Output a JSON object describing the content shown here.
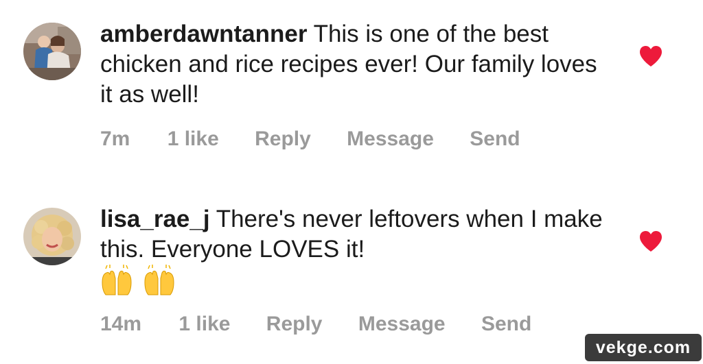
{
  "comments": [
    {
      "username": "amberdawntanner",
      "text": "This is one of the best chicken and rice recipes ever! Our family loves it as well!",
      "time": "7m",
      "likes": "1 like",
      "reply": "Reply",
      "message": "Message",
      "send": "Send",
      "liked": true
    },
    {
      "username": "lisa_rae_j",
      "text": "There's never leftovers when I make this.  Everyone LOVES it!",
      "emoji": "raising-hands-emoji x2",
      "time": "14m",
      "likes": "1 like",
      "reply": "Reply",
      "message": "Message",
      "send": "Send",
      "liked": true
    }
  ],
  "watermark": "vekge.com",
  "colors": {
    "heart": "#ed1a3b",
    "meta_text": "#9a9a9a",
    "body_text": "#1b1b1b"
  }
}
